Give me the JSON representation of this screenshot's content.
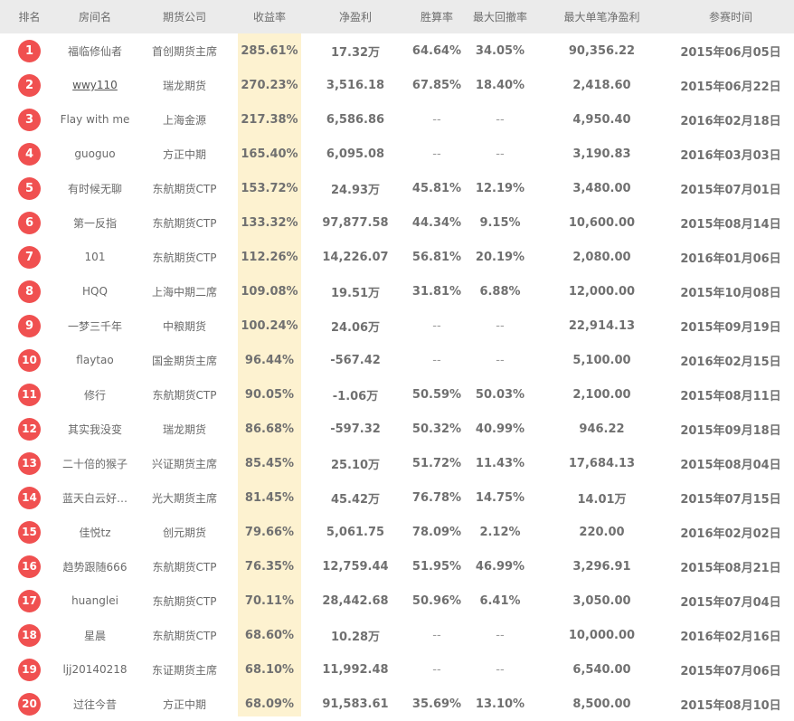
{
  "headers": [
    "排名",
    "房间名",
    "期货公司",
    "收益率",
    "净盈利",
    "胜算率",
    "最大回撤率",
    "最大单笔净盈利",
    "参赛时间"
  ],
  "rows": [
    {
      "rank": "1",
      "room": "福临修仙者",
      "company": "首创期货主席",
      "yield": "285.61%",
      "profit": "17.32万",
      "win": "64.64%",
      "drawdown": "34.05%",
      "maxsingle": "90,356.22",
      "date": "2015年06月05日",
      "link": false
    },
    {
      "rank": "2",
      "room": "wwy110",
      "company": "瑞龙期货",
      "yield": "270.23%",
      "profit": "3,516.18",
      "win": "67.85%",
      "drawdown": "18.40%",
      "maxsingle": "2,418.60",
      "date": "2015年06月22日",
      "link": true
    },
    {
      "rank": "3",
      "room": "Flay with me",
      "company": "上海金源",
      "yield": "217.38%",
      "profit": "6,586.86",
      "win": "--",
      "drawdown": "--",
      "maxsingle": "4,950.40",
      "date": "2016年02月18日",
      "link": false
    },
    {
      "rank": "4",
      "room": "guoguo",
      "company": "方正中期",
      "yield": "165.40%",
      "profit": "6,095.08",
      "win": "--",
      "drawdown": "--",
      "maxsingle": "3,190.83",
      "date": "2016年03月03日",
      "link": false
    },
    {
      "rank": "5",
      "room": "有时候无聊",
      "company": "东航期货CTP",
      "yield": "153.72%",
      "profit": "24.93万",
      "win": "45.81%",
      "drawdown": "12.19%",
      "maxsingle": "3,480.00",
      "date": "2015年07月01日",
      "link": false
    },
    {
      "rank": "6",
      "room": "第一反指",
      "company": "东航期货CTP",
      "yield": "133.32%",
      "profit": "97,877.58",
      "win": "44.34%",
      "drawdown": "9.15%",
      "maxsingle": "10,600.00",
      "date": "2015年08月14日",
      "link": false
    },
    {
      "rank": "7",
      "room": "101",
      "company": "东航期货CTP",
      "yield": "112.26%",
      "profit": "14,226.07",
      "win": "56.81%",
      "drawdown": "20.19%",
      "maxsingle": "2,080.00",
      "date": "2016年01月06日",
      "link": false
    },
    {
      "rank": "8",
      "room": "HQQ",
      "company": "上海中期二席",
      "yield": "109.08%",
      "profit": "19.51万",
      "win": "31.81%",
      "drawdown": "6.88%",
      "maxsingle": "12,000.00",
      "date": "2015年10月08日",
      "link": false
    },
    {
      "rank": "9",
      "room": "一梦三千年",
      "company": "中粮期货",
      "yield": "100.24%",
      "profit": "24.06万",
      "win": "--",
      "drawdown": "--",
      "maxsingle": "22,914.13",
      "date": "2015年09月19日",
      "link": false
    },
    {
      "rank": "10",
      "room": "flaytao",
      "company": "国金期货主席",
      "yield": "96.44%",
      "profit": "-567.42",
      "win": "--",
      "drawdown": "--",
      "maxsingle": "5,100.00",
      "date": "2016年02月15日",
      "link": false
    },
    {
      "rank": "11",
      "room": "修行",
      "company": "东航期货CTP",
      "yield": "90.05%",
      "profit": "-1.06万",
      "win": "50.59%",
      "drawdown": "50.03%",
      "maxsingle": "2,100.00",
      "date": "2015年08月11日",
      "link": false
    },
    {
      "rank": "12",
      "room": "其实我没变",
      "company": "瑞龙期货",
      "yield": "86.68%",
      "profit": "-597.32",
      "win": "50.32%",
      "drawdown": "40.99%",
      "maxsingle": "946.22",
      "date": "2015年09月18日",
      "link": false
    },
    {
      "rank": "13",
      "room": "二十倍的猴子",
      "company": "兴证期货主席",
      "yield": "85.45%",
      "profit": "25.10万",
      "win": "51.72%",
      "drawdown": "11.43%",
      "maxsingle": "17,684.13",
      "date": "2015年08月04日",
      "link": false
    },
    {
      "rank": "14",
      "room": "蓝天白云好…",
      "company": "光大期货主席",
      "yield": "81.45%",
      "profit": "45.42万",
      "win": "76.78%",
      "drawdown": "14.75%",
      "maxsingle": "14.01万",
      "date": "2015年07月15日",
      "link": false
    },
    {
      "rank": "15",
      "room": "佳悦tz",
      "company": "创元期货",
      "yield": "79.66%",
      "profit": "5,061.75",
      "win": "78.09%",
      "drawdown": "2.12%",
      "maxsingle": "220.00",
      "date": "2016年02月02日",
      "link": false
    },
    {
      "rank": "16",
      "room": "趋势跟随666",
      "company": "东航期货CTP",
      "yield": "76.35%",
      "profit": "12,759.44",
      "win": "51.95%",
      "drawdown": "46.99%",
      "maxsingle": "3,296.91",
      "date": "2015年08月21日",
      "link": false
    },
    {
      "rank": "17",
      "room": "huanglei",
      "company": "东航期货CTP",
      "yield": "70.11%",
      "profit": "28,442.68",
      "win": "50.96%",
      "drawdown": "6.41%",
      "maxsingle": "3,050.00",
      "date": "2015年07月04日",
      "link": false
    },
    {
      "rank": "18",
      "room": "星晨",
      "company": "东航期货CTP",
      "yield": "68.60%",
      "profit": "10.28万",
      "win": "--",
      "drawdown": "--",
      "maxsingle": "10,000.00",
      "date": "2016年02月16日",
      "link": false
    },
    {
      "rank": "19",
      "room": "ljj20140218",
      "company": "东证期货主席",
      "yield": "68.10%",
      "profit": "11,992.48",
      "win": "--",
      "drawdown": "--",
      "maxsingle": "6,540.00",
      "date": "2015年07月06日",
      "link": false
    },
    {
      "rank": "20",
      "room": "过往今昔",
      "company": "方正中期",
      "yield": "68.09%",
      "profit": "91,583.61",
      "win": "35.69%",
      "drawdown": "13.10%",
      "maxsingle": "8,500.00",
      "date": "2015年08月10日",
      "link": false
    }
  ],
  "colors": {
    "badge": "#f05050",
    "yield_bg": "#fdf2d0",
    "header_bg": "#ebebeb"
  }
}
